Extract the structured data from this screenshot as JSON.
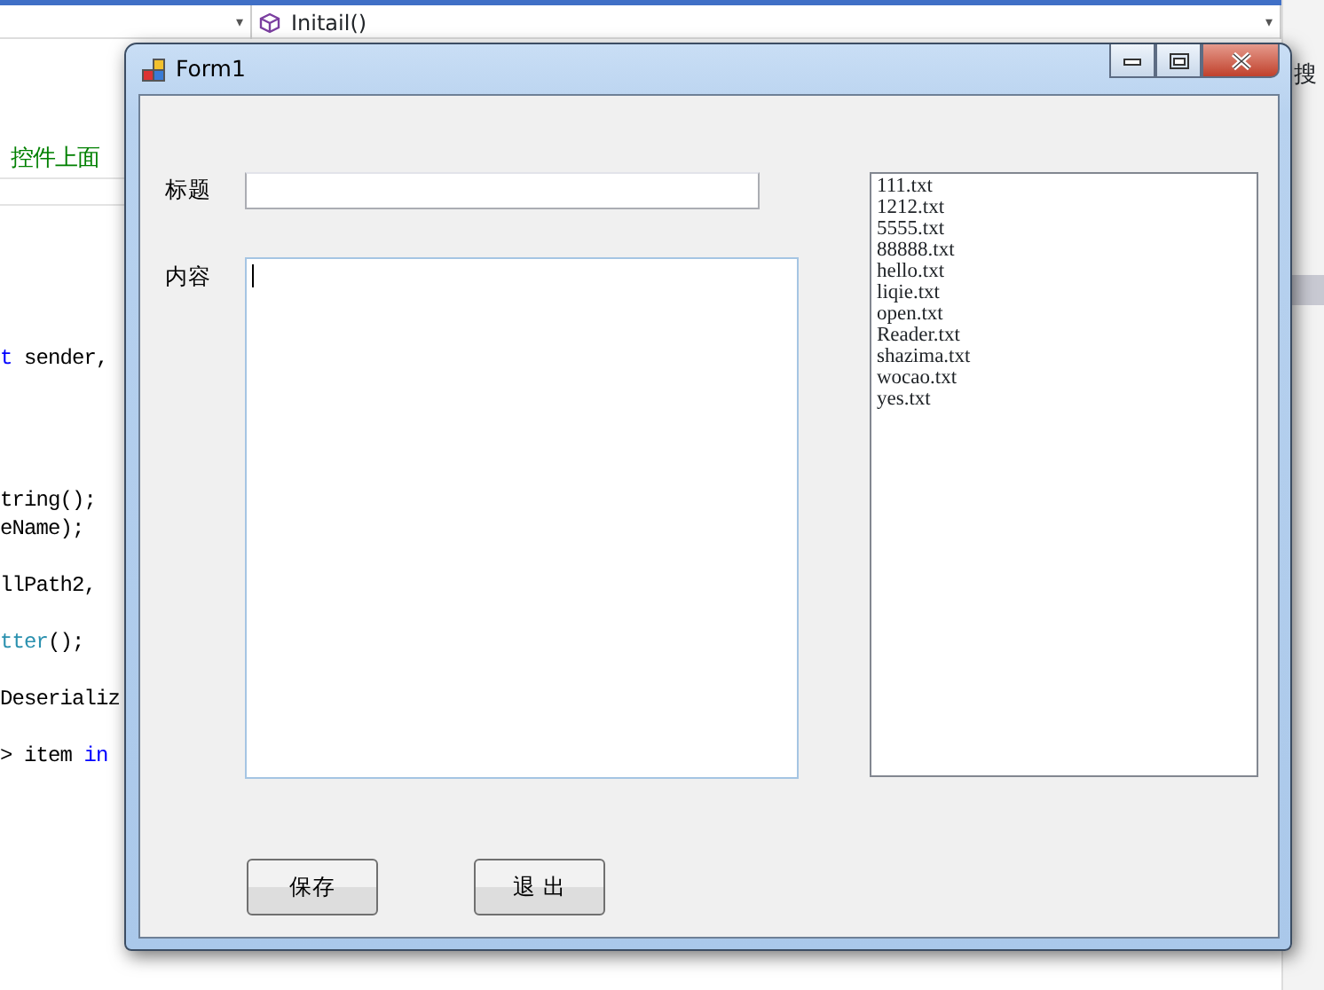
{
  "editor": {
    "dropdowns": [
      {
        "caret": "▾"
      },
      {
        "text": "Initail()",
        "caret": "▾"
      }
    ],
    "code_lines": [
      {
        "segments": [
          {
            "kind": "comment",
            "text": "控件上面"
          }
        ]
      },
      {
        "segments": [
          {
            "kind": "keyword",
            "text": "t"
          },
          {
            "kind": "plain",
            "text": " sender,"
          }
        ]
      },
      {
        "segments": [
          {
            "kind": "plain",
            "text": "tring();"
          }
        ]
      },
      {
        "segments": [
          {
            "kind": "plain",
            "text": "eName);"
          }
        ]
      },
      {
        "segments": [
          {
            "kind": "plain",
            "text": "llPath2,"
          }
        ]
      },
      {
        "segments": [
          {
            "kind": "type",
            "text": "tter"
          },
          {
            "kind": "plain",
            "text": "();"
          }
        ]
      },
      {
        "segments": [
          {
            "kind": "plain",
            "text": "Deserializ"
          }
        ]
      },
      {
        "segments": [
          {
            "kind": "plain",
            "text": "> item "
          },
          {
            "kind": "keyword",
            "text": "in"
          }
        ]
      }
    ],
    "side_panel": {
      "search_label": "搜"
    }
  },
  "window": {
    "title": "Form1",
    "title_field": {
      "label": "标题"
    },
    "content_field": {
      "label": "内容",
      "focused": true
    },
    "file_list": [
      "111.txt",
      "1212.txt",
      "5555.txt",
      "88888.txt",
      "hello.txt",
      "liqie.txt",
      "open.txt",
      "Reader.txt",
      "shazima.txt",
      "wocao.txt",
      "yes.txt"
    ],
    "buttons": [
      "保存",
      "退 出"
    ]
  }
}
